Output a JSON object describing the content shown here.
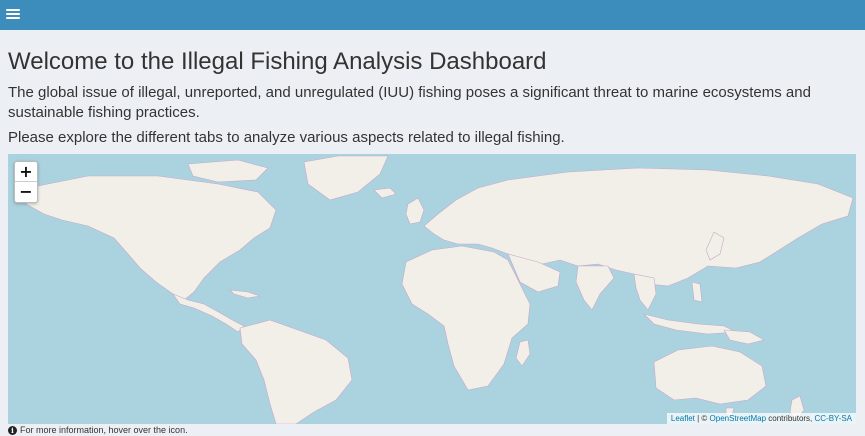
{
  "header": {
    "menu_icon": "hamburger-icon",
    "color": "#3c8dbc"
  },
  "main": {
    "title": "Welcome to the Illegal Fishing Analysis Dashboard",
    "intro": "The global issue of illegal, unreported, and unregulated (IUU) fishing poses a significant threat to marine ecosystems and sustainable fishing practices.",
    "explore": "Please explore the different tabs to analyze various aspects related to illegal fishing."
  },
  "map": {
    "water_color": "#aad3df",
    "land_color": "#f2efe9",
    "zoom_in_label": "+",
    "zoom_out_label": "−",
    "attribution": {
      "leaflet": "Leaflet",
      "separator": " | © ",
      "osm": "OpenStreetMap",
      "contributors": " contributors, ",
      "license": "CC-BY-SA"
    }
  },
  "footer": {
    "info_icon": "info-icon",
    "text": "For more information, hover over the icon."
  }
}
